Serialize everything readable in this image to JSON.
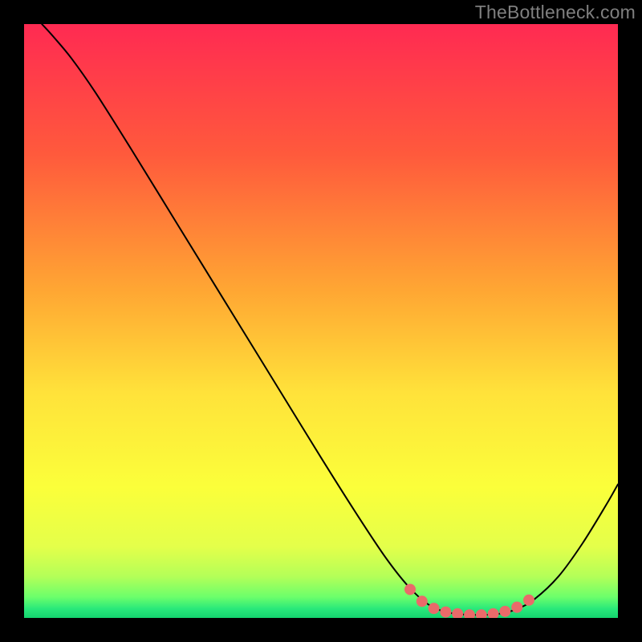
{
  "watermark": "TheBottleneck.com",
  "chart_data": {
    "type": "line",
    "title": "",
    "xlabel": "",
    "ylabel": "",
    "xlim": [
      0,
      100
    ],
    "ylim": [
      0,
      100
    ],
    "gradient_stops": [
      {
        "offset": 0,
        "color": "#ff2a52"
      },
      {
        "offset": 0.22,
        "color": "#ff5a3c"
      },
      {
        "offset": 0.45,
        "color": "#ffa733"
      },
      {
        "offset": 0.62,
        "color": "#ffe23a"
      },
      {
        "offset": 0.78,
        "color": "#fbff3a"
      },
      {
        "offset": 0.88,
        "color": "#e4ff4a"
      },
      {
        "offset": 0.93,
        "color": "#b4ff58"
      },
      {
        "offset": 0.965,
        "color": "#6bff6b"
      },
      {
        "offset": 0.985,
        "color": "#28e87a"
      },
      {
        "offset": 1.0,
        "color": "#14d36e"
      }
    ],
    "series": [
      {
        "name": "bottleneck-curve",
        "color": "#000000",
        "stroke_width": 2,
        "is_main_curve": true,
        "points": [
          {
            "x": 3.0,
            "y": 100.0
          },
          {
            "x": 5.0,
            "y": 97.8
          },
          {
            "x": 8.0,
            "y": 94.2
          },
          {
            "x": 12.0,
            "y": 88.5
          },
          {
            "x": 18.0,
            "y": 79.0
          },
          {
            "x": 26.0,
            "y": 66.0
          },
          {
            "x": 34.0,
            "y": 53.0
          },
          {
            "x": 42.0,
            "y": 40.0
          },
          {
            "x": 50.0,
            "y": 27.0
          },
          {
            "x": 56.0,
            "y": 17.5
          },
          {
            "x": 61.0,
            "y": 10.0
          },
          {
            "x": 65.0,
            "y": 5.0
          },
          {
            "x": 68.5,
            "y": 2.0
          },
          {
            "x": 72.0,
            "y": 0.8
          },
          {
            "x": 76.0,
            "y": 0.5
          },
          {
            "x": 80.0,
            "y": 0.7
          },
          {
            "x": 83.0,
            "y": 1.5
          },
          {
            "x": 86.0,
            "y": 3.2
          },
          {
            "x": 90.0,
            "y": 7.0
          },
          {
            "x": 94.0,
            "y": 12.5
          },
          {
            "x": 98.0,
            "y": 19.0
          },
          {
            "x": 100.0,
            "y": 22.5
          }
        ]
      },
      {
        "name": "optimal-band-markers",
        "color": "#ea6a6a",
        "marker_radius": 7,
        "is_markers": true,
        "points": [
          {
            "x": 65.0,
            "y": 4.8
          },
          {
            "x": 67.0,
            "y": 2.8
          },
          {
            "x": 69.0,
            "y": 1.6
          },
          {
            "x": 71.0,
            "y": 1.0
          },
          {
            "x": 73.0,
            "y": 0.7
          },
          {
            "x": 75.0,
            "y": 0.5
          },
          {
            "x": 77.0,
            "y": 0.5
          },
          {
            "x": 79.0,
            "y": 0.7
          },
          {
            "x": 81.0,
            "y": 1.1
          },
          {
            "x": 83.0,
            "y": 1.8
          },
          {
            "x": 85.0,
            "y": 3.0
          }
        ]
      }
    ]
  }
}
